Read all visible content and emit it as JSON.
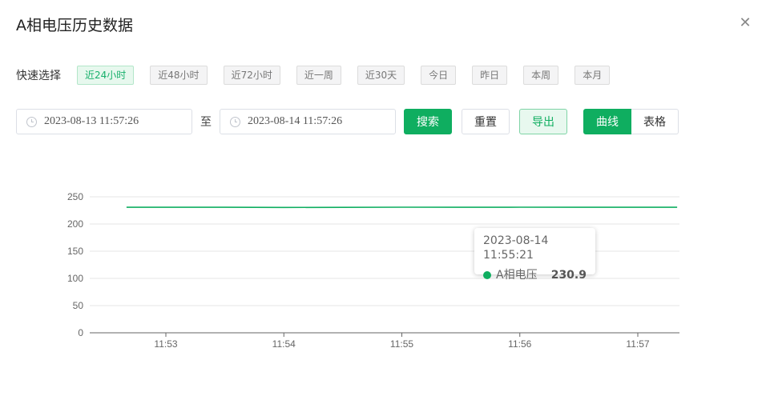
{
  "dialog": {
    "title": "A相电压历史数据",
    "close_icon": "close-icon"
  },
  "quick_select": {
    "label": "快速选择",
    "options": [
      "近24小时",
      "近48小时",
      "近72小时",
      "近一周",
      "近30天",
      "今日",
      "昨日",
      "本周",
      "本月"
    ],
    "active": "近24小时"
  },
  "filter": {
    "start": "2023-08-13 11:57:26",
    "separator": "至",
    "end": "2023-08-14 11:57:26",
    "search_label": "搜索",
    "reset_label": "重置",
    "export_label": "导出",
    "view_curve": "曲线",
    "view_table": "表格",
    "active_view": "曲线"
  },
  "colors": {
    "accent": "#0fae60",
    "series": "#0fae60"
  },
  "chart_data": {
    "type": "line",
    "x": [
      "11:52:40",
      "11:53:00",
      "11:53:30",
      "11:54:00",
      "11:54:30",
      "11:55:00",
      "11:55:30",
      "11:56:00",
      "11:56:30",
      "11:57:00",
      "11:57:20"
    ],
    "series": [
      {
        "name": "A相电压",
        "values": [
          230.8,
          230.8,
          230.7,
          230.4,
          230.6,
          230.9,
          230.8,
          230.9,
          230.7,
          230.8,
          230.8
        ]
      }
    ],
    "xticks": [
      "11:53",
      "11:54",
      "11:55",
      "11:56",
      "11:57"
    ],
    "yticks": [
      0,
      50,
      100,
      150,
      200,
      250
    ],
    "ylim": [
      0,
      250
    ],
    "grid": true,
    "tooltip": {
      "time": "2023-08-14 11:55:21",
      "series": "A相电压",
      "value": "230.9"
    }
  }
}
